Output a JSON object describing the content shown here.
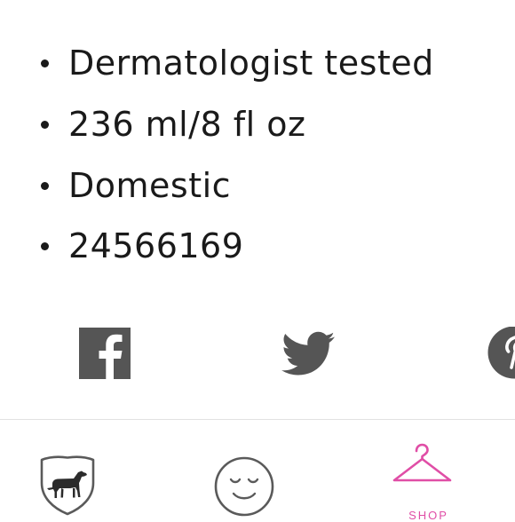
{
  "product_details": {
    "items": [
      "Dermatologist tested",
      "236 ml/8 fl oz",
      "Domestic",
      "24566169"
    ]
  },
  "share": {
    "icons": [
      "facebook-icon",
      "twitter-icon",
      "pinterest-icon"
    ],
    "icon_color": "#555555"
  },
  "tabbar": {
    "tabs": [
      {
        "icon": "pink-dog-shield-icon",
        "label": "",
        "active": false
      },
      {
        "icon": "smiley-face-icon",
        "label": "",
        "active": false
      },
      {
        "icon": "hanger-icon",
        "label": "SHOP",
        "active": true
      }
    ],
    "active_color": "#e04ea6",
    "inactive_color": "#5a5a5a"
  }
}
